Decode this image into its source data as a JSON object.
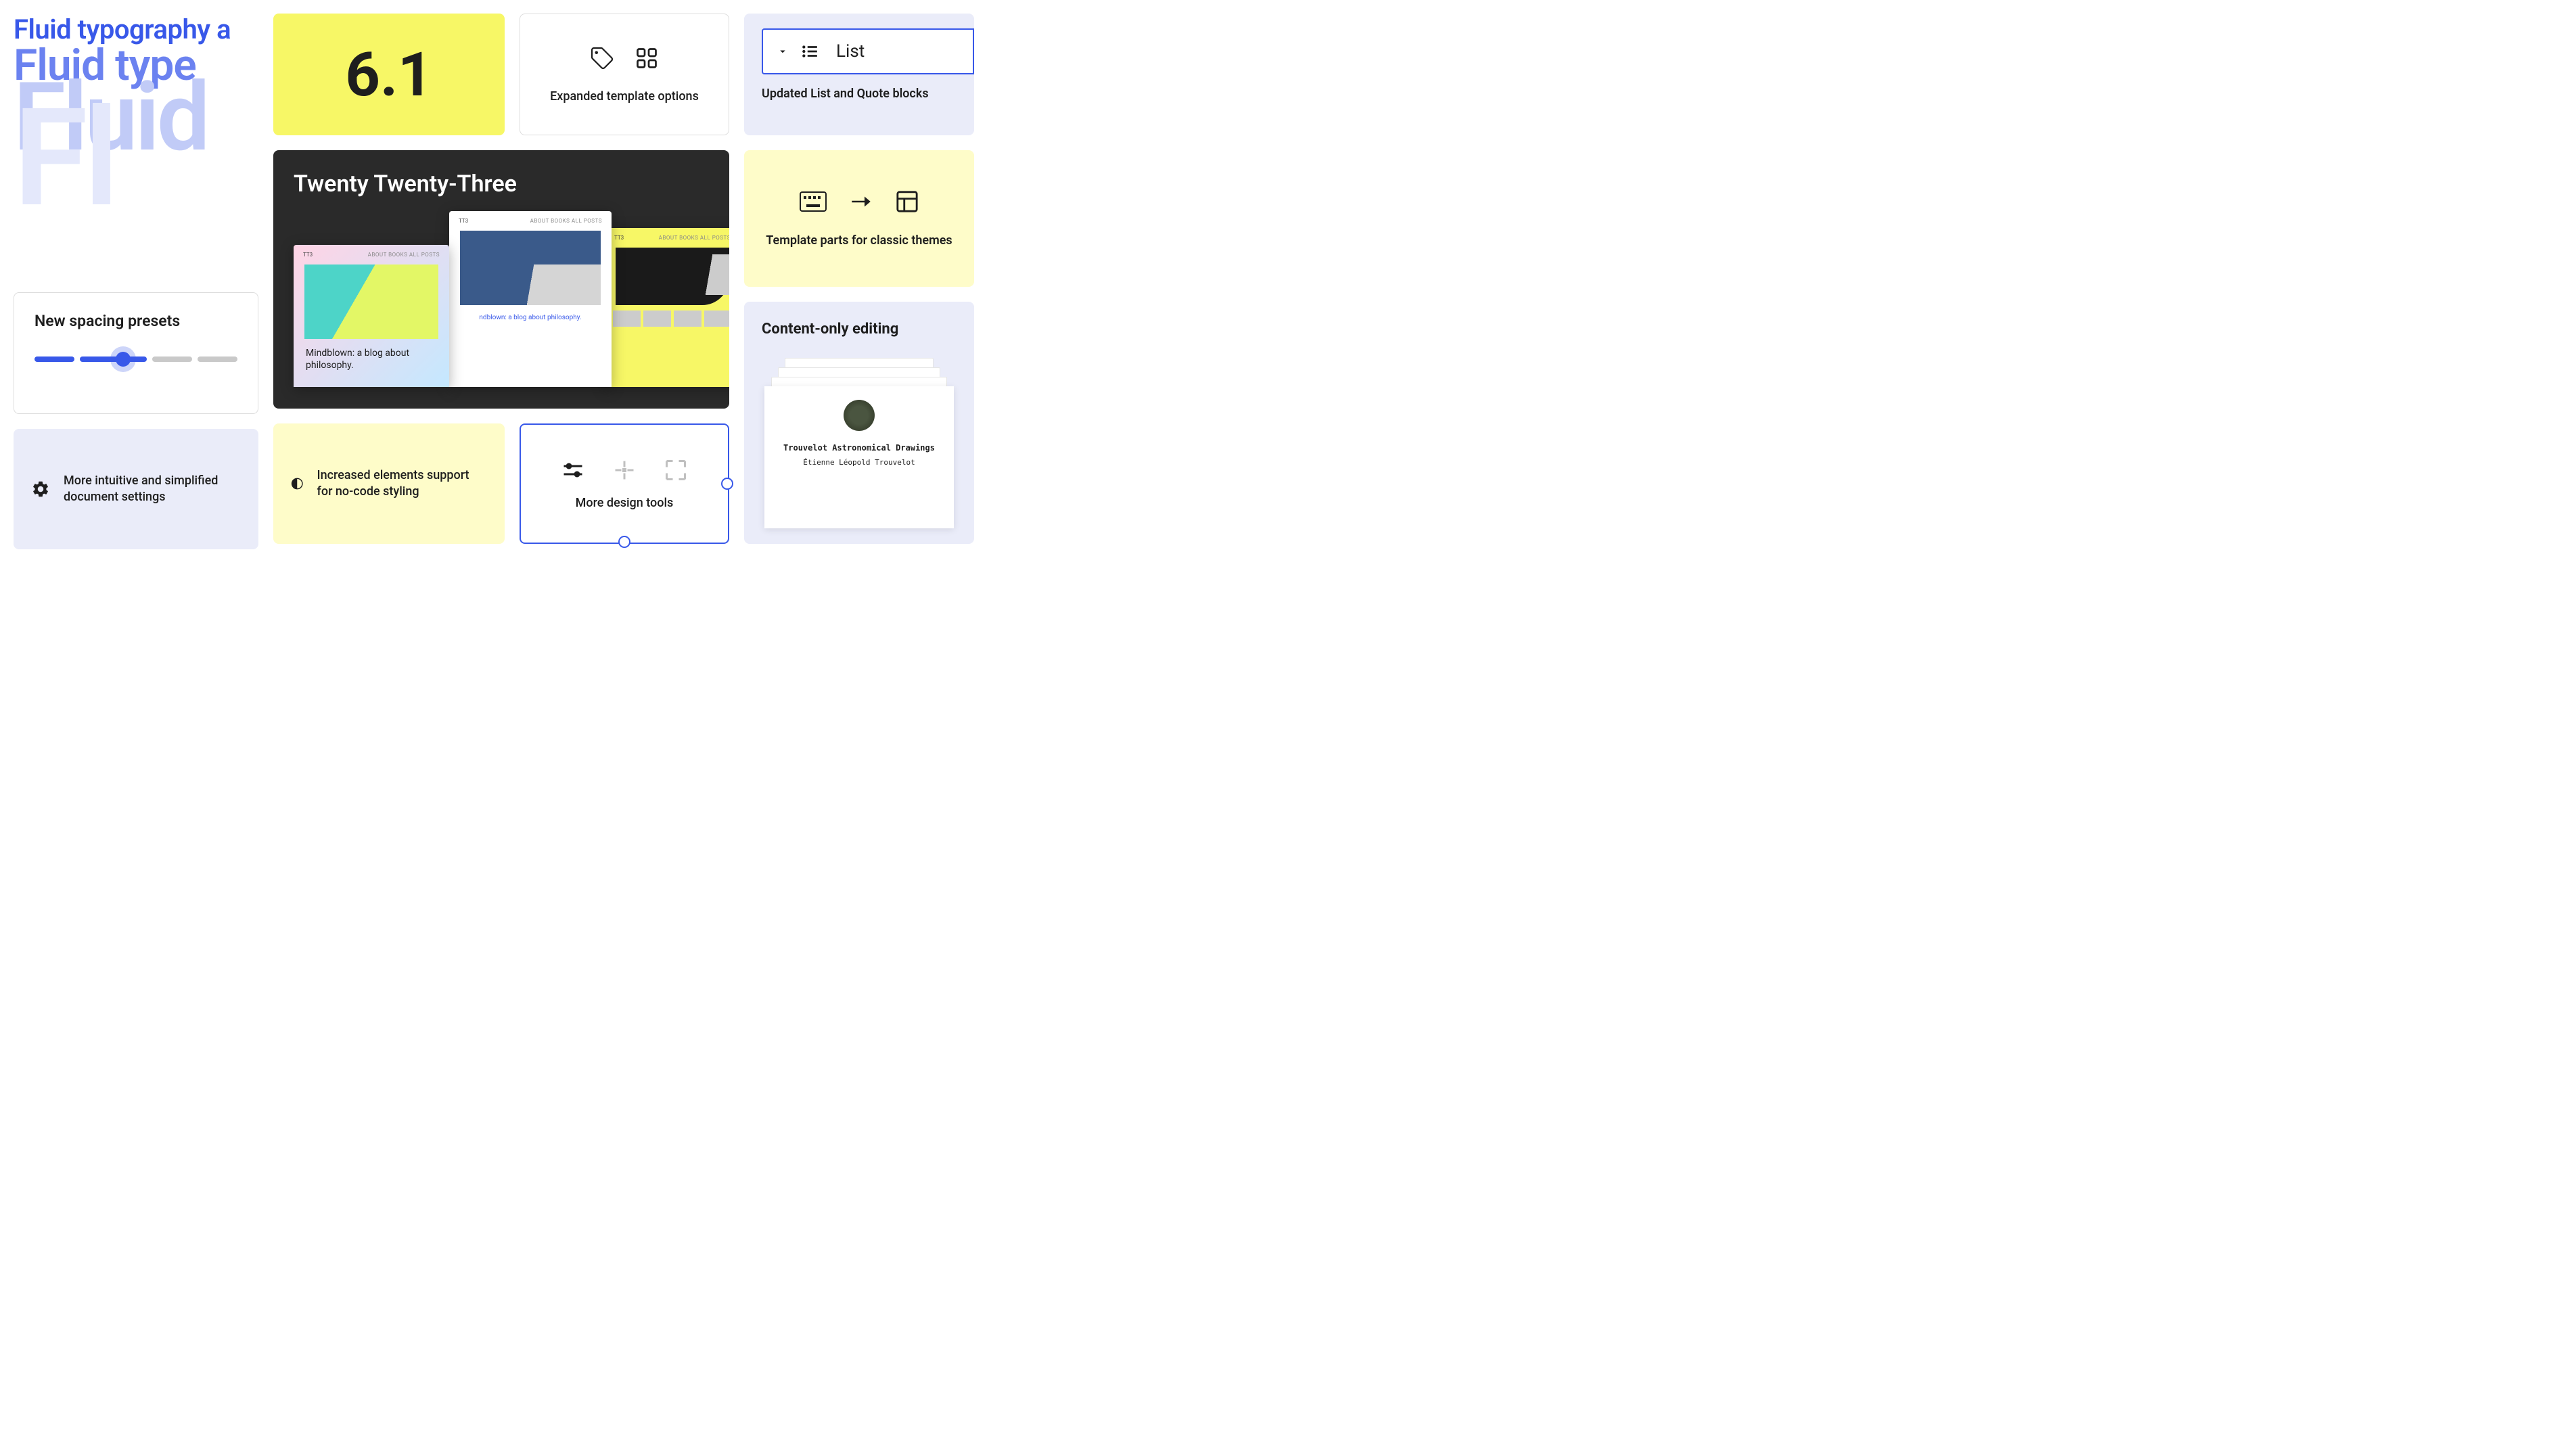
{
  "fluidTypography": {
    "line1": "Fluid typography a",
    "line2": "Fluid type",
    "line3": "Fluid",
    "line4": "Fl"
  },
  "version": {
    "number": "6.1"
  },
  "expandedTemplate": {
    "caption": "Expanded template options"
  },
  "listBlock": {
    "label": "List",
    "caption": "Updated List and Quote blocks"
  },
  "templateParts": {
    "caption": "Template parts for classic themes"
  },
  "spacingPresets": {
    "title": "New spacing presets"
  },
  "twentyTwentyThree": {
    "title": "Twenty Twenty-Three",
    "siteName": "TT3",
    "nav": "ABOUT  BOOKS  ALL POSTS",
    "blogCaption": "Mindblown: a blog about philosophy.",
    "blogCaptionShort": "ndblown: a blog about philosophy."
  },
  "contentOnly": {
    "title": "Content-only editing",
    "docTitle": "Trouvelot Astronomical Drawings",
    "docAuthor": "Étienne Léopold Trouvelot"
  },
  "documentSettings": {
    "text": "More intuitive and simplified document settings"
  },
  "noCodeStyling": {
    "text": "Increased elements support for no-code styling"
  },
  "designTools": {
    "caption": "More design tools"
  }
}
